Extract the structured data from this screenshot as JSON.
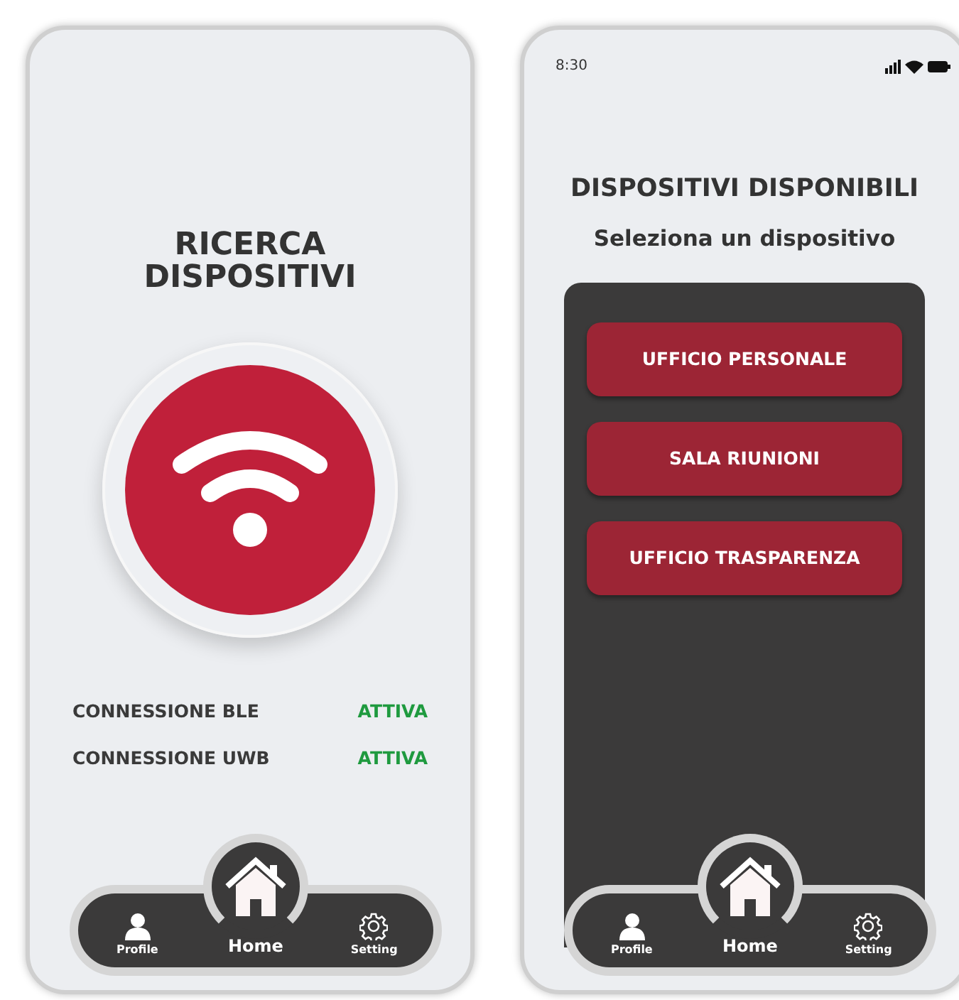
{
  "screens": [
    {
      "kind": "search",
      "title": "RICERCA DISPOSITIVI",
      "connections": [
        {
          "label": "CONNESSIONE BLE",
          "status": "ATTIVA"
        },
        {
          "label": "CONNESSIONE UWB",
          "status": "ATTIVA"
        }
      ],
      "nav": [
        {
          "kind": "profile",
          "label": "Profile",
          "selected": false
        },
        {
          "kind": "home",
          "label": "Home",
          "selected": true
        },
        {
          "kind": "settings",
          "label": "Setting",
          "selected": false
        }
      ]
    },
    {
      "kind": "list",
      "status_bar": {
        "time": "8:30"
      },
      "title": "DISPOSITIVI DISPONIBILI",
      "subtitle": "Seleziona un dispositivo",
      "devices": [
        {
          "label": "UFFICIO PERSONALE"
        },
        {
          "label": "SALA RIUNIONI"
        },
        {
          "label": "UFFICIO TRASPARENZA"
        }
      ],
      "nav": [
        {
          "kind": "profile",
          "label": "Profile",
          "selected": false
        },
        {
          "kind": "home",
          "label": "Home",
          "selected": true
        },
        {
          "kind": "settings",
          "label": "Setting",
          "selected": false
        }
      ]
    }
  ]
}
